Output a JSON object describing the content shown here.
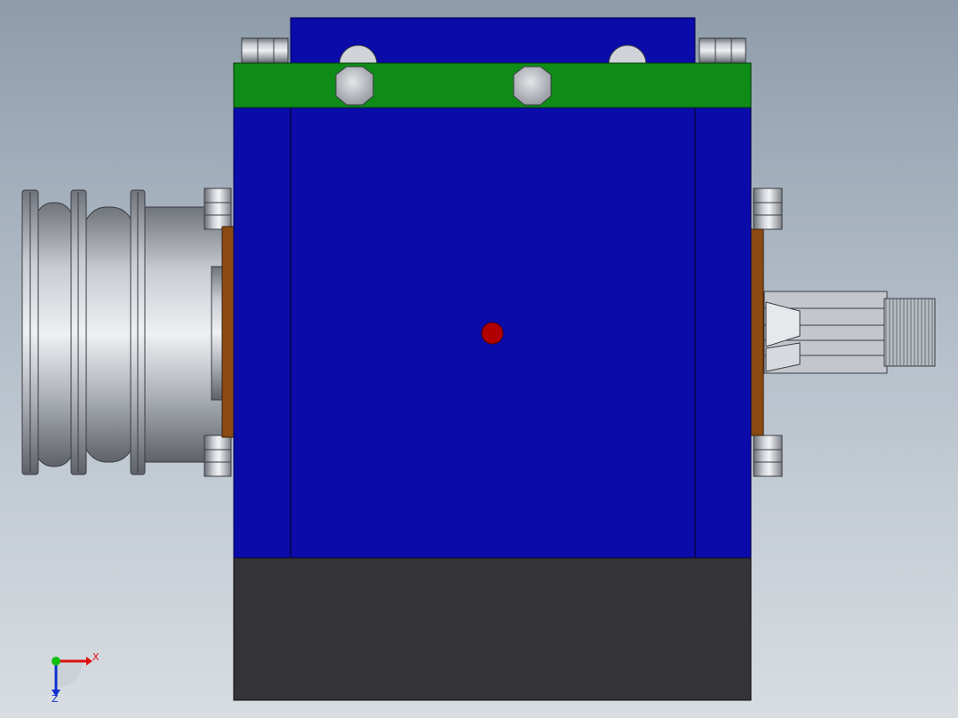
{
  "viewport": {
    "colors": {
      "housing": "#0a0ba8",
      "top_plate": "#0f8c17",
      "base": "#333338",
      "gasket": "#8a4a12",
      "center_mark": "#b00000",
      "steel": "#b4b8bf"
    }
  },
  "triad": {
    "x_label": "X",
    "z_label": "Z",
    "x_color": "#e01010",
    "z_color": "#1030d0",
    "y_color": "#10c010"
  }
}
